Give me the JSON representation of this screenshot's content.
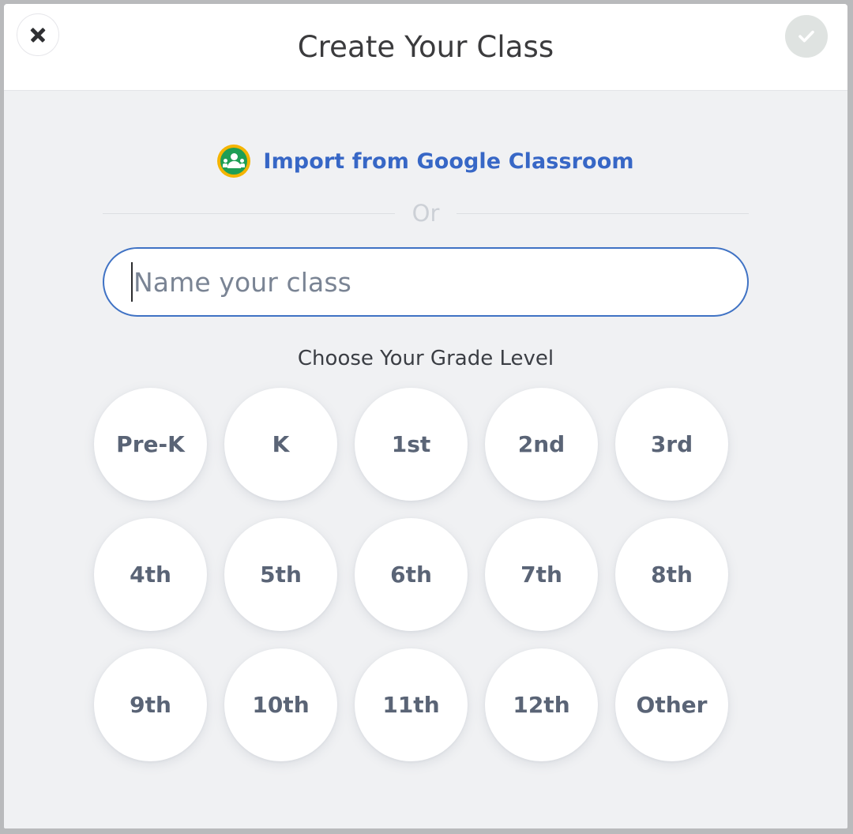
{
  "header": {
    "title": "Create Your Class",
    "close_icon": "close-x-icon",
    "confirm_icon": "check-icon",
    "confirm_state": "disabled",
    "confirm_bg_color": "#dfe3e1"
  },
  "import": {
    "icon": "google-classroom-icon",
    "label": "Import from Google Classroom",
    "link_color": "#3767c6"
  },
  "divider": {
    "label": "Or"
  },
  "class_name": {
    "value": "",
    "placeholder": "Name your class",
    "border_color": "#3f72c4",
    "focused": true
  },
  "grade_section": {
    "heading": "Choose Your Grade Level",
    "options": [
      {
        "label": "Pre-K"
      },
      {
        "label": "K"
      },
      {
        "label": "1st"
      },
      {
        "label": "2nd"
      },
      {
        "label": "3rd"
      },
      {
        "label": "4th"
      },
      {
        "label": "5th"
      },
      {
        "label": "6th"
      },
      {
        "label": "7th"
      },
      {
        "label": "8th"
      },
      {
        "label": "9th"
      },
      {
        "label": "10th"
      },
      {
        "label": "11th"
      },
      {
        "label": "12th"
      },
      {
        "label": "Other"
      }
    ]
  },
  "colors": {
    "background": "#f0f1f3",
    "header_background": "#ffffff",
    "title_text": "#3b3b3d",
    "grade_text": "#5a6476"
  }
}
